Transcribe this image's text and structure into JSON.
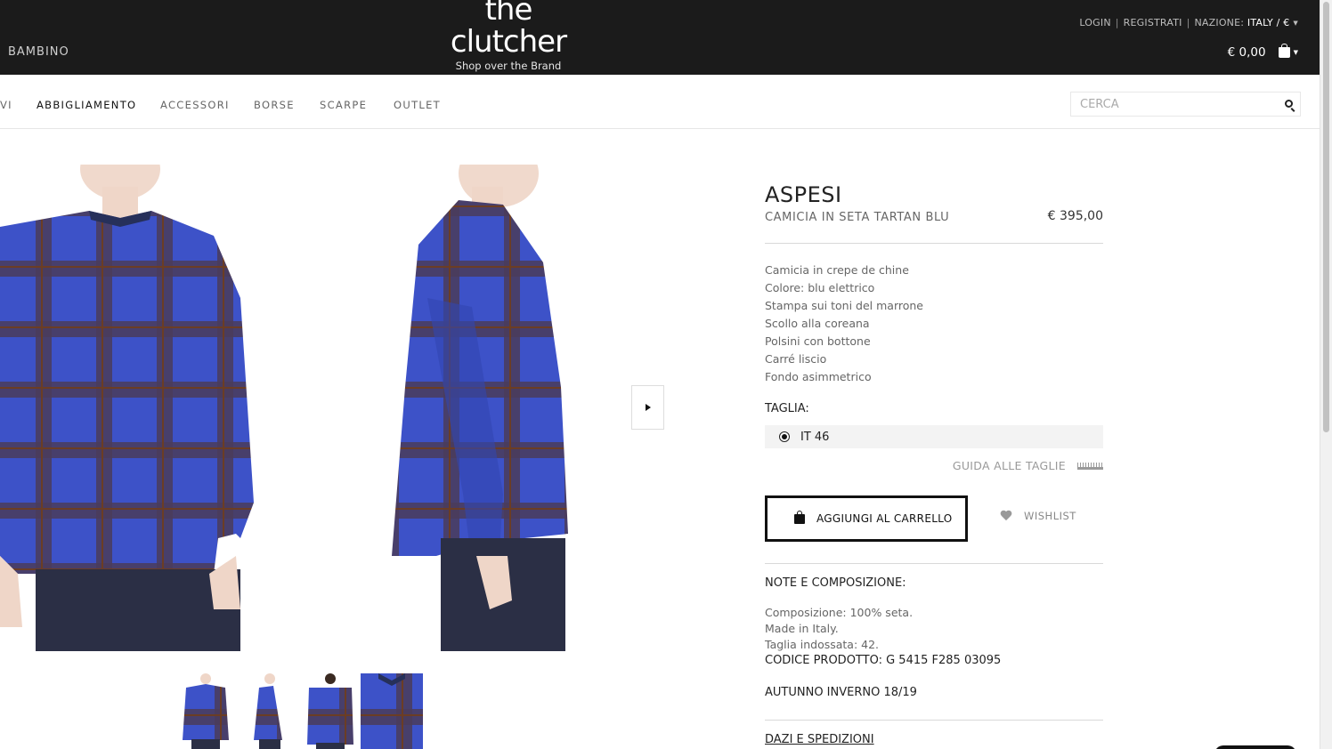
{
  "header": {
    "left_menu": "BAMBINO",
    "logo": {
      "line1": "the",
      "line2": "clutcher",
      "tagline": "Shop over the Brand"
    },
    "links": {
      "login": "LOGIN",
      "register": "REGISTRATI",
      "nation_label": "NAZIONE:",
      "nation_value": "ITALY / €"
    },
    "cart_total": "€ 0,00"
  },
  "nav": {
    "items": [
      "VI",
      "ABBIGLIAMENTO",
      "ACCESSORI",
      "BORSE",
      "SCARPE",
      "OUTLET"
    ],
    "active": "ABBIGLIAMENTO",
    "search_placeholder": "CERCA"
  },
  "product": {
    "brand": "ASPESI",
    "name": "CAMICIA IN SETA TARTAN BLU",
    "price": "€ 395,00",
    "description": [
      "Camicia in crepe de chine",
      "Colore: blu elettrico",
      "Stampa sui toni del marrone",
      "Scollo alla coreana",
      "Polsini con bottone",
      "Carré liscio",
      "Fondo asimmetrico"
    ],
    "size_label": "TAGLIA:",
    "sizes": [
      {
        "label": "IT 46",
        "selected": true
      }
    ],
    "size_guide": "GUIDA ALLE TAGLIE",
    "add_to_cart": "AGGIUNGI AL CARRELLO",
    "wishlist": "WISHLIST",
    "notes_title": "NOTE E COMPOSIZIONE:",
    "notes": [
      "Composizione: 100% seta.",
      "Made in Italy.",
      "Taglia indossata: 42."
    ],
    "product_code": "CODICE PRODOTTO: G 5415 F285 03095",
    "season": "AUTUNNO INVERNO 18/19",
    "shipping_link": "DAZI E SPEDIZIONI"
  },
  "colors": {
    "header_bg": "#1b1b1b",
    "shirt_blue": "#3d52c8",
    "tartan_brown": "#5a3a2a",
    "jeans": "#2b2f45"
  },
  "icons": [
    "bag-icon",
    "search-icon",
    "chevron-right-icon",
    "heart-icon",
    "ruler-icon",
    "radio-selected-icon"
  ]
}
